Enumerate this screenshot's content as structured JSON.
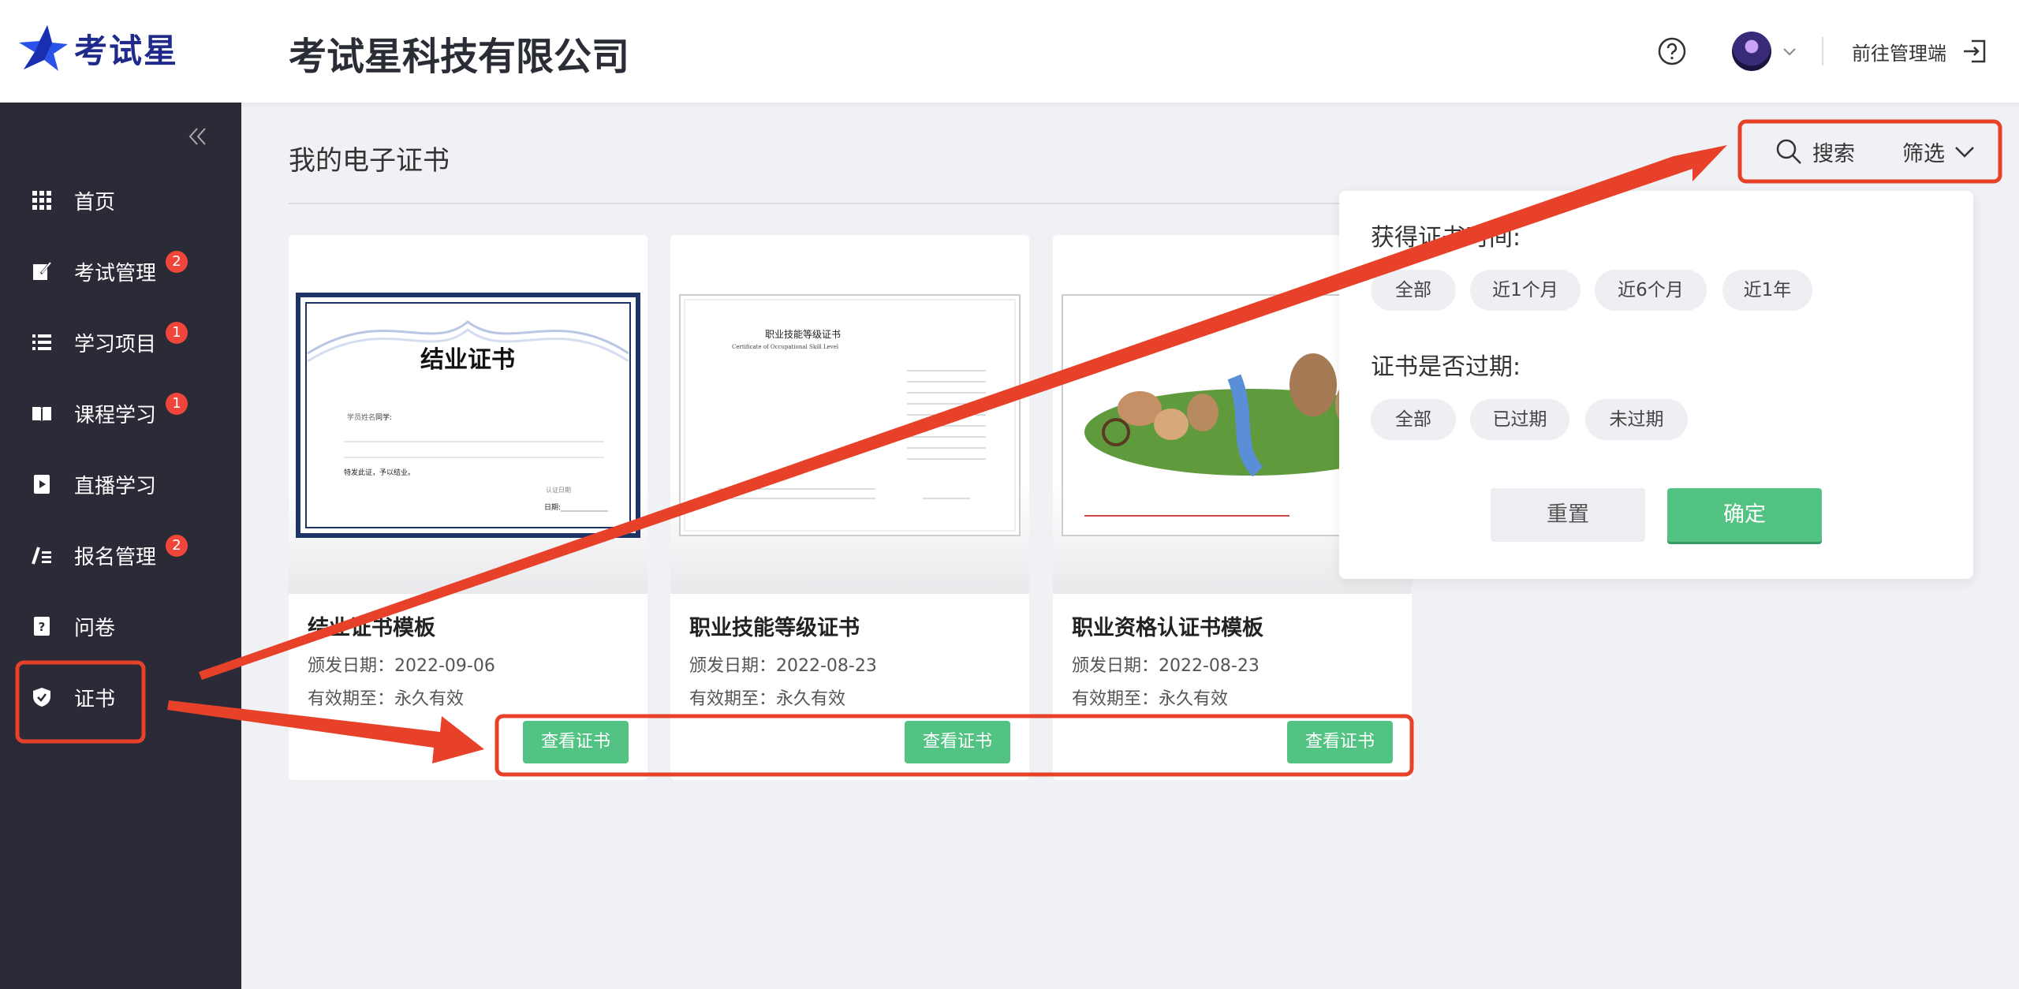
{
  "app": {
    "logo_text": "考试星",
    "company": "考试星科技有限公司"
  },
  "header": {
    "admin_link": "前往管理端"
  },
  "sidebar": {
    "items": [
      {
        "label": "首页",
        "badge": ""
      },
      {
        "label": "考试管理",
        "badge": "2"
      },
      {
        "label": "学习项目",
        "badge": "1"
      },
      {
        "label": "课程学习",
        "badge": "1"
      },
      {
        "label": "直播学习",
        "badge": ""
      },
      {
        "label": "报名管理",
        "badge": "2"
      },
      {
        "label": "问卷",
        "badge": ""
      },
      {
        "label": "证书",
        "badge": ""
      }
    ]
  },
  "main": {
    "title": "我的电子证书",
    "search_label": "搜索",
    "filter_label": "筛选"
  },
  "cards": [
    {
      "name": "结业证书模板",
      "issue_date": "颁发日期：2022-09-06",
      "valid_until": "有效期至：永久有效",
      "button": "查看证书",
      "thumb_title": "结业证书",
      "thumb_fields": [
        "学员姓名",
        "同学:",
        "特发此证，予以结业。",
        "认证日期",
        "日期:"
      ]
    },
    {
      "name": "职业技能等级证书",
      "issue_date": "颁发日期：2022-08-23",
      "valid_until": "有效期至：永久有效",
      "button": "查看证书",
      "thumb_title": "职业技能等级证书",
      "thumb_subtitle": "Certificate of Occupational Skill Level"
    },
    {
      "name": "职业资格认证书模板",
      "issue_date": "颁发日期：2022-08-23",
      "valid_until": "有效期至：永久有效",
      "button": "查看证书"
    }
  ],
  "filter": {
    "time_heading": "获得证书时间:",
    "time_options": [
      "全部",
      "近1个月",
      "近6个月",
      "近1年"
    ],
    "expired_heading": "证书是否过期:",
    "expired_options": [
      "全部",
      "已过期",
      "未过期"
    ],
    "reset": "重置",
    "confirm": "确定"
  },
  "colors": {
    "accent_green": "#52c383",
    "sidebar_bg": "#2a2b37",
    "badge_red": "#f0453a",
    "annotation_red": "#e8412a"
  }
}
